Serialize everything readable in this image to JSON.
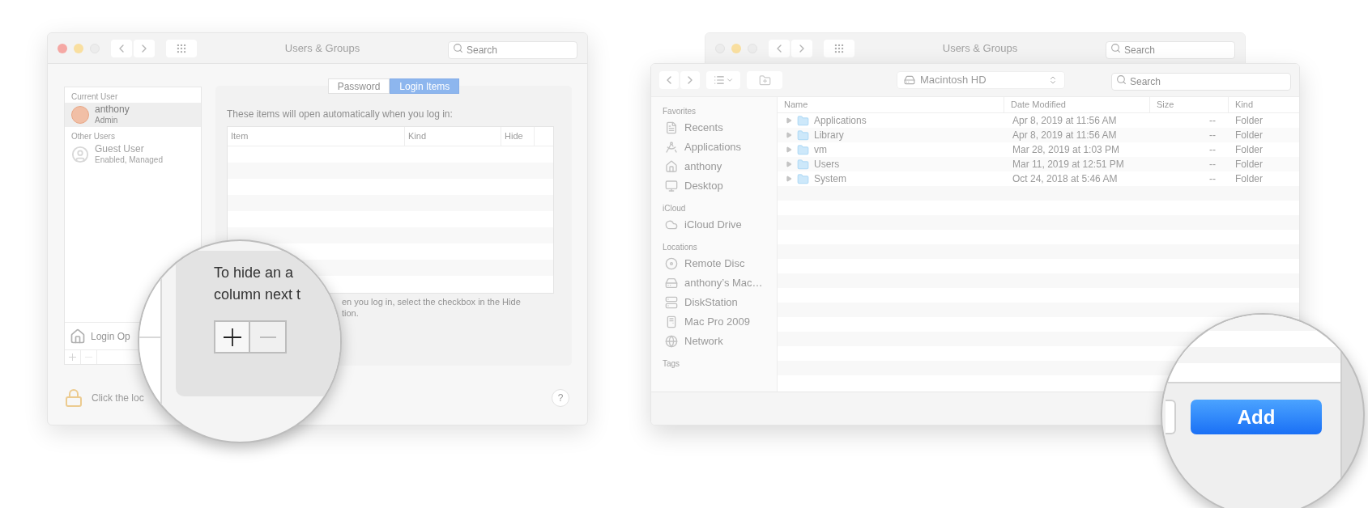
{
  "prefs_window": {
    "title": "Users & Groups",
    "search": {
      "placeholder": "Search"
    },
    "user_sections": [
      {
        "heading": "Current User",
        "users": [
          {
            "name": "anthony",
            "role": "Admin",
            "selected": true,
            "kind": "avatar"
          }
        ]
      },
      {
        "heading": "Other Users",
        "users": [
          {
            "name": "Guest User",
            "role": "Enabled, Managed",
            "selected": false,
            "kind": "guest"
          }
        ]
      }
    ],
    "login_options": "Login Op",
    "tabs": [
      {
        "label": "Password",
        "selected": false
      },
      {
        "label": "Login Items",
        "selected": true
      }
    ],
    "intro": "These items will open automatically when you log in:",
    "table": {
      "columns": [
        "Item",
        "Kind",
        "Hide"
      ]
    },
    "note_lines": [
      "en you log in, select the checkbox in the Hide",
      "tion."
    ],
    "lock_text": "Click the loc",
    "help": "?"
  },
  "left_magnifier": {
    "lines": [
      "To hide an a",
      "column next t"
    ]
  },
  "back_window": {
    "title": "Users & Groups",
    "search": {
      "placeholder": "Search"
    }
  },
  "finder_window": {
    "location": "Macintosh HD",
    "search": {
      "placeholder": "Search"
    },
    "sidebar": [
      {
        "heading": "Favorites",
        "items": [
          {
            "label": "Recents",
            "kind": "recents"
          },
          {
            "label": "Applications",
            "kind": "applications"
          },
          {
            "label": "anthony",
            "kind": "home"
          },
          {
            "label": "Desktop",
            "kind": "desktop"
          }
        ]
      },
      {
        "heading": "iCloud",
        "items": [
          {
            "label": "iCloud Drive",
            "kind": "cloud"
          }
        ]
      },
      {
        "heading": "Locations",
        "items": [
          {
            "label": "Remote Disc",
            "kind": "disc"
          },
          {
            "label": "anthony’s Mac…",
            "kind": "drive"
          },
          {
            "label": "DiskStation",
            "kind": "server"
          },
          {
            "label": "Mac Pro 2009",
            "kind": "computer"
          },
          {
            "label": "Network",
            "kind": "network"
          }
        ]
      },
      {
        "heading": "Tags"
      }
    ],
    "columns": [
      "Name",
      "Date Modified",
      "Size",
      "Kind"
    ],
    "rows": [
      {
        "name": "Applications",
        "date_modified": "Apr 8, 2019 at 11:56 AM",
        "size": "--",
        "kind_column": "Folder"
      },
      {
        "name": "Library",
        "date_modified": "Apr 8, 2019 at 11:56 AM",
        "size": "--",
        "kind_column": "Folder"
      },
      {
        "name": "vm",
        "date_modified": "Mar 28, 2019 at 1:03 PM",
        "size": "--",
        "kind_column": "Folder"
      },
      {
        "name": "Users",
        "date_modified": "Mar 11, 2019 at 12:51 PM",
        "size": "--",
        "kind_column": "Folder"
      },
      {
        "name": "System",
        "date_modified": "Oct 24, 2018 at 5:46 AM",
        "size": "--",
        "kind_column": "Folder"
      }
    ]
  },
  "right_magnifier": {
    "button": "Add"
  }
}
